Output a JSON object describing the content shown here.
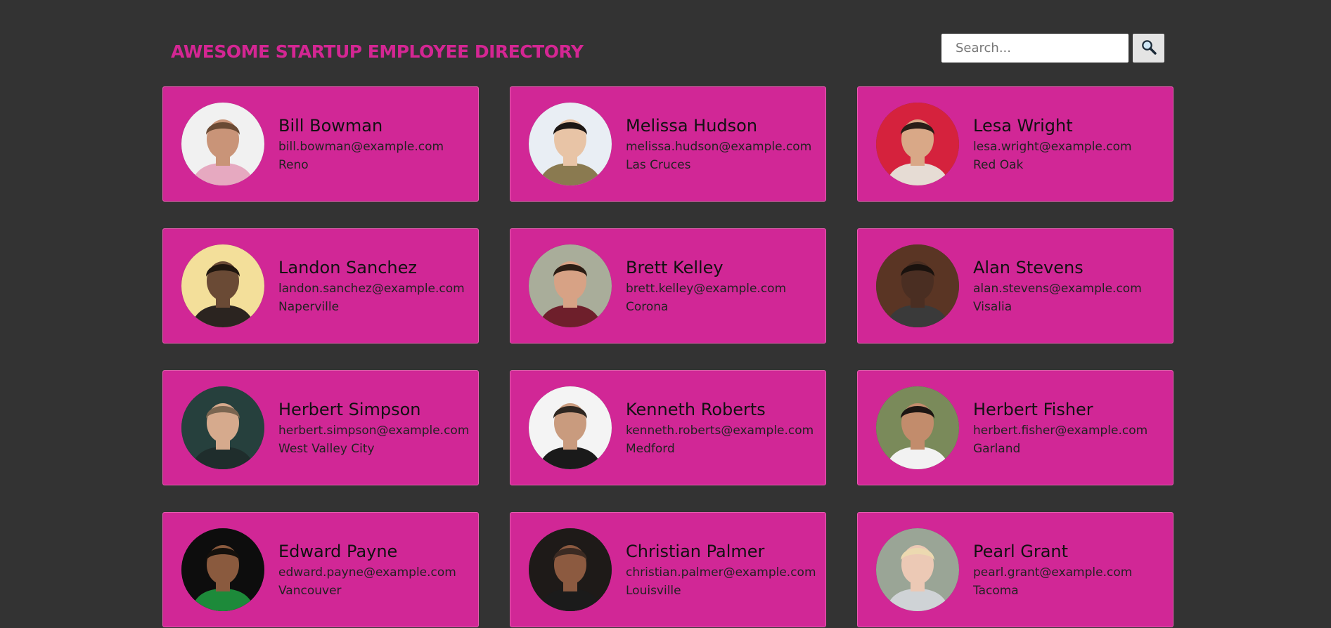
{
  "header": {
    "title": "AWESOME STARTUP EMPLOYEE DIRECTORY"
  },
  "search": {
    "placeholder": "Search...",
    "button_icon": "magnifier-icon"
  },
  "colors": {
    "background": "#333333",
    "accent": "#d42693",
    "card": "#d12796"
  },
  "employees": [
    {
      "name": "Bill Bowman",
      "email": "bill.bowman@example.com",
      "city": "Reno",
      "skin": "#c99478",
      "hair": "#6a4a34",
      "shirt": "#e6a9c0",
      "bg": "#f1f1f1"
    },
    {
      "name": "Melissa Hudson",
      "email": "melissa.hudson@example.com",
      "city": "Las Cruces",
      "skin": "#e8c4a6",
      "hair": "#1d1714",
      "shirt": "#8a7a50",
      "bg": "#e9eef4"
    },
    {
      "name": "Lesa Wright",
      "email": "lesa.wright@example.com",
      "city": "Red Oak",
      "skin": "#d9a887",
      "hair": "#2a1e18",
      "shirt": "#e6dcd4",
      "bg": "#d5223d"
    },
    {
      "name": "Landon Sanchez",
      "email": "landon.sanchez@example.com",
      "city": "Naperville",
      "skin": "#6a4a35",
      "hair": "#20160f",
      "shirt": "#2b2420",
      "bg": "#f3df9a"
    },
    {
      "name": "Brett Kelley",
      "email": "brett.kelley@example.com",
      "city": "Corona",
      "skin": "#d7a285",
      "hair": "#2c1d14",
      "shirt": "#6e1f2b",
      "bg": "#a9ad9a"
    },
    {
      "name": "Alan Stevens",
      "email": "alan.stevens@example.com",
      "city": "Visalia",
      "skin": "#4a2e22",
      "hair": "#1a120e",
      "shirt": "#3a3a3a",
      "bg": "#5a3524"
    },
    {
      "name": "Herbert Simpson",
      "email": "herbert.simpson@example.com",
      "city": "West Valley City",
      "skin": "#d6aa8d",
      "hair": "#7a6550",
      "shirt": "#1f2d2c",
      "bg": "#26403d"
    },
    {
      "name": "Kenneth Roberts",
      "email": "kenneth.roberts@example.com",
      "city": "Medford",
      "skin": "#c99b7e",
      "hair": "#2e2620",
      "shirt": "#1a1a1a",
      "bg": "#f4f4f4"
    },
    {
      "name": "Herbert Fisher",
      "email": "herbert.fisher@example.com",
      "city": "Garland",
      "skin": "#c28c6c",
      "hair": "#1c1512",
      "shirt": "#f2f2f2",
      "bg": "#7a8a5a"
    },
    {
      "name": "Edward Payne",
      "email": "edward.payne@example.com",
      "city": "Vancouver",
      "skin": "#8a5a3e",
      "hair": "#15100c",
      "shirt": "#1d8a3a",
      "bg": "#0d0d0d"
    },
    {
      "name": "Christian Palmer",
      "email": "christian.palmer@example.com",
      "city": "Louisville",
      "skin": "#8c5a40",
      "hair": "#3b2a22",
      "shirt": "#1b1b1b",
      "bg": "#1e1a18"
    },
    {
      "name": "Pearl Grant",
      "email": "pearl.grant@example.com",
      "city": "Tacoma",
      "skin": "#ecc9b5",
      "hair": "#ecd9b0",
      "shirt": "#cfd3d6",
      "bg": "#9aa596"
    }
  ]
}
